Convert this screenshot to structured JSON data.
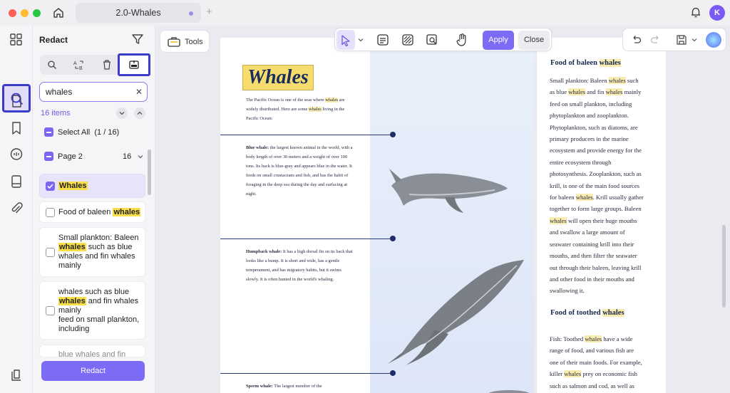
{
  "window": {
    "tab_title": "2.0-Whales",
    "avatar_initial": "K"
  },
  "colors": {
    "accent": "#7b6bf5",
    "highlight": "#f8df4a",
    "focus_border": "#3a3acb"
  },
  "rail": {
    "icons": [
      "grid-icon",
      "search-icon",
      "page-icon",
      "bookmark-icon",
      "comment-icon",
      "file-icon",
      "paperclip-icon",
      "layers-icon"
    ]
  },
  "panel": {
    "title": "Redact",
    "search_value": "whales",
    "items_count": "16 items",
    "select_all": "Select All",
    "select_all_count": "(1 / 16)",
    "page_label": "Page 2",
    "page_count": "16",
    "results": [
      {
        "before": "",
        "hit": "Whales",
        "after": "",
        "checked": true
      },
      {
        "before": "Food of baleen ",
        "hit": "whales",
        "after": "",
        "checked": false
      },
      {
        "before": "Small plankton: Baleen ",
        "hit": "whales",
        "after": " such as blue whales and fin whales mainly",
        "checked": false
      },
      {
        "before": "whales such as blue ",
        "hit": "whales",
        "after": " and fin whales mainly\nfeed on small plankton, including",
        "checked": false
      },
      {
        "before": "blue whales and fin",
        "hit": "",
        "after": "",
        "checked": false
      }
    ],
    "redact_button": "Redact"
  },
  "toolbar": {
    "tools_label": "Tools",
    "apply_label": "Apply",
    "close_label": "Close"
  },
  "document": {
    "title": "Whales",
    "intro_a": "The Pacific Ocean is one of the seas where ",
    "intro_hl": "whales",
    "intro_b": " are widely distributed. Here are some ",
    "intro_hl2": "whales",
    "intro_c": " living in the Pacific Ocean:",
    "blue_head": "Blue whale:",
    "blue_text": " the largest known animal in the world, with a body length of over 30 meters and a weight of over 100 tons. Its back is blue-gray and appears blue in the water. It feeds on small crustaceans and fish, and has the habit of foraging in the deep sea during the day and surfacing at night.",
    "humpback_head": "Humpback whale:",
    "humpback_text": " It has a high dorsal fin on its back that looks like a hump. It is short and wide, has a gentle temperament, and has migratory habits, but it swims slowly. It is often hunted in the world's whaling.",
    "sperm_head": "Sperm whale:",
    "sperm_text": " The largest member of the",
    "food_baleen_head": "Food of baleen ",
    "food_baleen_hl": "whales",
    "baleen_lines": [
      "Small plankton: Baleen |whales| such",
      "as blue |whales| and fin |whales| mainly",
      "feed on small plankton, including",
      "phytoplankton and zooplankton.",
      "Phytoplankton, such as diatoms, are",
      "primary producers in the marine",
      "ecosystem and provide energy for the",
      "entire ecosystem through",
      "photosynthesis. Zooplankton, such as",
      "krill, is one of the main food sources",
      "for baleen |whales|. Krill usually gather",
      "together to form large groups. Baleen",
      "|whales| will open their huge mouths",
      "and swallow a large amount of",
      "seawater containing krill into their",
      "mouths, and then filter the seawater",
      "out through their baleen, leaving krill",
      "and other food in their mouths and",
      "swallowing it."
    ],
    "food_toothed_head": "Food of toothed ",
    "food_toothed_hl": "whales",
    "toothed_lines": [
      "Fish: Toothed |whales| have a wide",
      "range of food, and various fish are",
      "one of their main foods. For example,",
      "killer |whales| prey on economic fish",
      "such as salmon and cod, as well as"
    ]
  }
}
